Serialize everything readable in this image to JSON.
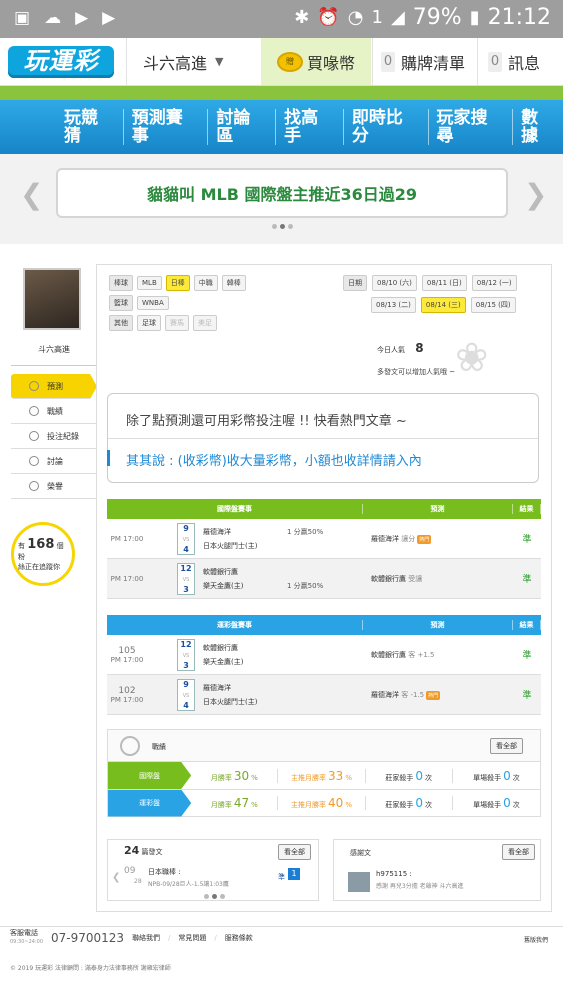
{
  "status": {
    "battery": "79%",
    "time": "21:12",
    "sim": "1"
  },
  "header": {
    "logo": "玩運彩",
    "user": "斗六高進",
    "buy_coin": "買喙幣",
    "coin_badge": "贈",
    "cart_count": "0",
    "cart": "購牌清單",
    "msg_count": "0",
    "messages": "訊息"
  },
  "nav": {
    "items": [
      "玩競猜",
      "預測賽事",
      "討論區",
      "找高手",
      "即時比分",
      "玩家搜尋",
      "數據"
    ]
  },
  "banner": {
    "text": "貓貓叫 MLB 國際盤主推近36日過29"
  },
  "sidebar": {
    "username": "斗六高進",
    "menu": [
      "預測",
      "戰績",
      "投注紀錄",
      "討論",
      "榮譽"
    ],
    "follow_prefix": "有",
    "follow_count": "168",
    "follow_unit": "個粉",
    "follow_text": "絲正在追蹤你"
  },
  "filters": {
    "baseball_label": "棒球",
    "baseball": [
      "MLB",
      "日棒",
      "中職",
      "韓棒"
    ],
    "basketball_label": "籃球",
    "basketball": [
      "WNBA"
    ],
    "other_label": "其他",
    "other": [
      "足球",
      "賽馬",
      "美足"
    ]
  },
  "dates": {
    "label": "日期",
    "row1": [
      "08/10 (六)",
      "08/11 (日)",
      "08/12 (一)"
    ],
    "row2": [
      "08/13 (二)",
      "08/14 (三)",
      "08/15 (四)"
    ]
  },
  "popularity": {
    "label": "今日人氣",
    "value": "8",
    "tip": "多發文可以增加人氣哦 ~"
  },
  "notice": {
    "line1": "除了點預測還可用彩幣投注喔 !! 快看熱門文章 ~",
    "line2": "其其說 : (收彩幣)收大量彩幣，小額也收詳情請入內"
  },
  "intl_table": {
    "header": [
      "國際盤賽事",
      "預測",
      "結果"
    ],
    "rows": [
      {
        "time": "PM 17:00",
        "away_score": "9",
        "home_score": "4",
        "away": "羅德海洋",
        "home": "日本火腿鬥士(主)",
        "handicap": "1 分贏50%",
        "pick": "羅德海洋",
        "pick_note": "讓分",
        "hot": "熱門",
        "result": "準"
      },
      {
        "time": "PM 17:00",
        "away_score": "12",
        "home_score": "3",
        "away": "軟體銀行鷹",
        "home": "樂天金鷹(主)",
        "handicap": "1 分贏50%",
        "pick": "軟體銀行鷹",
        "pick_note": "受讓",
        "hot": "",
        "result": "準"
      }
    ]
  },
  "local_table": {
    "header": [
      "運彩盤賽事",
      "預測",
      "結果"
    ],
    "rows": [
      {
        "no": "105",
        "time": "PM 17:00",
        "away_score": "12",
        "home_score": "3",
        "away": "軟體銀行鷹",
        "home": "樂天金鷹(主)",
        "pick": "軟體銀行鷹",
        "pick_note": "客 +1.5",
        "hot": "",
        "result": "準"
      },
      {
        "no": "102",
        "time": "PM 17:00",
        "away_score": "9",
        "home_score": "4",
        "away": "羅德海洋",
        "home": "日本火腿鬥士(主)",
        "pick": "羅德海洋",
        "pick_note": "客 -1.5",
        "hot": "熱門",
        "result": "準"
      }
    ]
  },
  "stats": {
    "title": "戰績",
    "view_all": "看全部",
    "intl": {
      "label": "國際盤",
      "win_rate": "30",
      "main_rate": "33",
      "streak": "0",
      "loss": "0"
    },
    "local": {
      "label": "運彩盤",
      "win_rate": "47",
      "main_rate": "40",
      "streak": "0",
      "loss": "0"
    },
    "labels": {
      "win": "月勝率",
      "main": "主推月勝率",
      "streak": "莊家殺手",
      "loss": "單場殺手",
      "pct": "%",
      "times": "次"
    }
  },
  "posts": {
    "count": "24",
    "label": "篇發文",
    "view_all": "看全部",
    "date_mo": "09",
    "date_day": "28",
    "title": "日本職棒 :",
    "sub": "NPB-09/28巨人-1.5讓1:03鷹",
    "tag": "準",
    "tag_num": "1"
  },
  "thanks": {
    "label": "感謝文",
    "view_all": "看全部",
    "user": "h975115 :",
    "text": "感謝 再兒3分擔 老爺神 斗六高進"
  },
  "footer": {
    "phone_label": "客服電話",
    "hours": "09:30~24:00",
    "phone": "07-9700123",
    "links": [
      "聯絡我們",
      "常見問題",
      "服務條款"
    ],
    "right": "舊版我們",
    "copyright": "© 2019 玩運彩  法律顧問 : 滿泰身力法律事務所 謝雍宏律師"
  }
}
